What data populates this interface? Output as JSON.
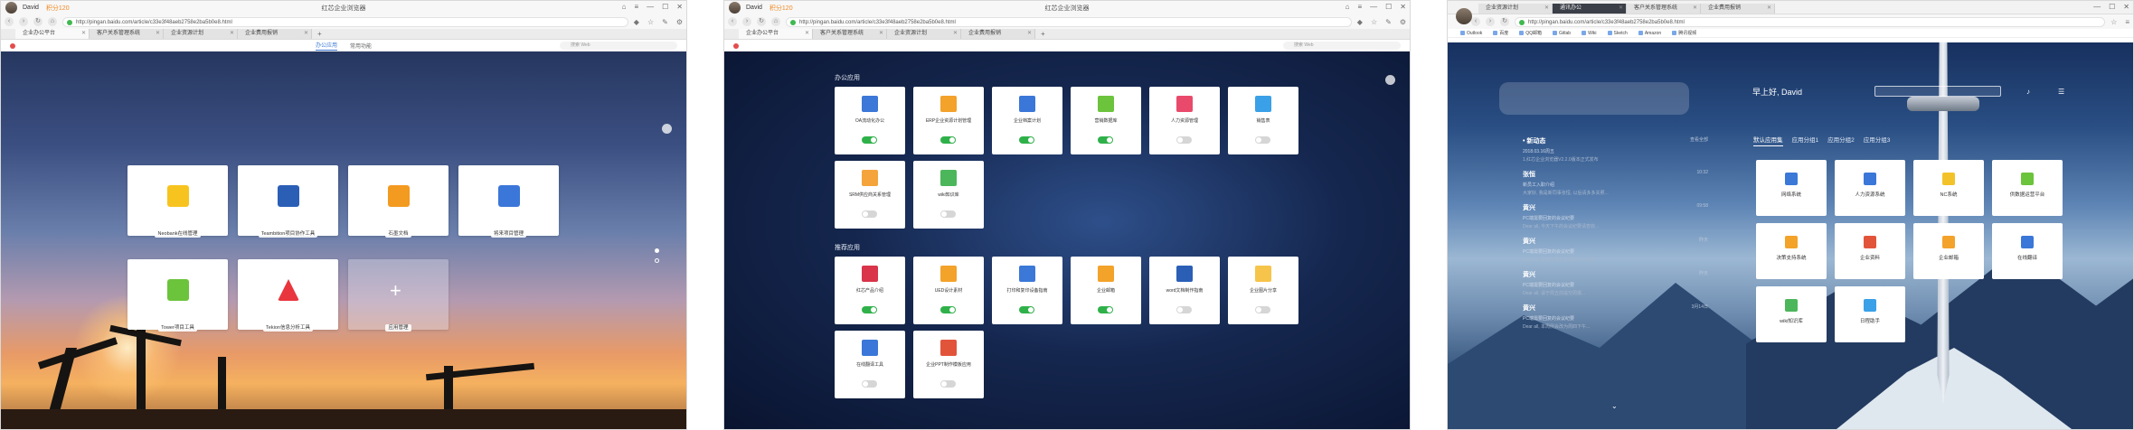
{
  "windows": [
    {
      "titlebar": {
        "user": "David",
        "score": "积分120",
        "title": "红芯企业浏览器"
      },
      "url": "http://pingan.baidu.com/article/c33e3f48aeb2758e2ba5b0e8.html",
      "tabs": [
        "企业办公平台",
        "客户关系管理系统",
        "企业资源计划",
        "企业费用报销"
      ],
      "subnav": [
        "办公应用",
        "常用功能"
      ],
      "search_placeholder": "搜索 Web",
      "apps": [
        {
          "label": "Neobank在线管理"
        },
        {
          "label": "Teambition项目协作工具"
        },
        {
          "label": "石墨文档"
        },
        {
          "label": "将来项目管理"
        },
        {
          "label": "Tower项目工具"
        },
        {
          "label": "Tekion信息分析工具"
        },
        {
          "label": "应用管理"
        }
      ]
    },
    {
      "titlebar": {
        "user": "David",
        "score": "积分120",
        "title": "红芯企业浏览器"
      },
      "url": "http://pingan.baidu.com/article/c33e3f48aeb2758e2ba5b0e8.html",
      "tabs": [
        "企业办公平台",
        "客户关系管理系统",
        "企业资源计划",
        "企业费用报销"
      ],
      "search_placeholder": "搜索 Web",
      "sections": [
        {
          "title": "办公应用",
          "apps": [
            {
              "label": "OA流动化办公",
              "on": true
            },
            {
              "label": "ERP企业资源计划管理",
              "on": true
            },
            {
              "label": "企业档案计划",
              "on": true
            },
            {
              "label": "营销数据库",
              "on": true
            },
            {
              "label": "人力资源管理",
              "on": false
            },
            {
              "label": "销售表",
              "on": false
            },
            {
              "label": "SRM供应商关系管理",
              "on": false
            },
            {
              "label": "wiki知识库",
              "on": false
            }
          ]
        },
        {
          "title": "推荐应用",
          "apps": [
            {
              "label": "红芯产品介绍",
              "on": true
            },
            {
              "label": "UED设计素材",
              "on": true
            },
            {
              "label": "打印和复印设备指南",
              "on": true
            },
            {
              "label": "企业邮箱",
              "on": true
            },
            {
              "label": "word文档制作指南",
              "on": false
            },
            {
              "label": "企业图片分享",
              "on": false
            },
            {
              "label": "在线翻译工具",
              "on": false
            },
            {
              "label": "企业PPT制作模板应用",
              "on": false
            }
          ]
        }
      ]
    },
    {
      "tabs": [
        "企业资源计划",
        "通讯办公",
        "客户关系管理系统",
        "企业费用报销"
      ],
      "url": "http://pingan.baidu.com/article/c33e3f48aeb2758e2ba5b0e8.html",
      "bookmarks": [
        "Outlook",
        "百度",
        "QQ邮箱",
        "Gitlab",
        "Wiki",
        "Sketch",
        "Amazon",
        "腾讯视频"
      ],
      "greeting": "早上好, David",
      "tabs_row": [
        "默认应用集",
        "应用分组1",
        "应用分组2",
        "应用分组3"
      ],
      "feed": [
        {
          "title": "• 新动态",
          "right": "查看全部",
          "desc": "2018.03.16周五",
          "desc2": "1.红芯企业浏览器V2.2.0版本正式发布"
        },
        {
          "title": "张恒",
          "right": "10:32",
          "desc": "新员工入职介绍",
          "desc2": "大家好, 我是新同事张恒, 以后请多多关照..."
        },
        {
          "title": "黄兴",
          "right": "09:58",
          "desc": "PC端需要回复的会议纪要",
          "desc2": "Dear all, 今天下午的会议纪要请查收..."
        },
        {
          "title": "黄兴",
          "right": "昨天",
          "desc": "PC端需要回复的会议纪要",
          "desc2": "Dear all, 请各位确认本周的工作安排..."
        },
        {
          "title": "黄兴",
          "right": "昨天",
          "desc": "PC端需要回复的会议纪要",
          "desc2": "Dear all, 请于周五前提交周报..."
        },
        {
          "title": "黄兴",
          "right": "3月14日",
          "desc": "PC端需要回复的会议纪要",
          "desc2": "Dear all, 本周例会改为周四下午..."
        }
      ],
      "apps": [
        "网络系统",
        "人力资源系统",
        "NC系统",
        "供数据运营平台",
        "决策支持系统",
        "企业资料",
        "企业邮箱",
        "在线翻译",
        "wiki知识库",
        "日程助手"
      ]
    }
  ]
}
